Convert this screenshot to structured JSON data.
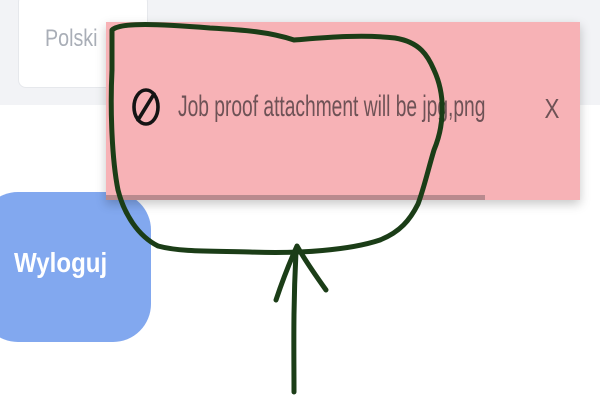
{
  "language_selector": {
    "value": "Polski"
  },
  "logout_button": {
    "label": "Wyloguj"
  },
  "toast": {
    "type": "error",
    "message": "Job proof attachment will be jpg,png",
    "close_label": "X",
    "icon": "ban-icon",
    "progress_fraction": 0.8
  },
  "annotation": {
    "kind": "hand-drawn circle with arrow pointing at the toast message",
    "color": "#1b3d17"
  },
  "colors": {
    "page_band": "#f2f3f6",
    "toast_background": "#f7b2b6",
    "toast_text": "#6e5256",
    "toast_progress": "#b98a8e",
    "logout_background": "#82a8ef",
    "language_text": "#a9aeb7"
  }
}
